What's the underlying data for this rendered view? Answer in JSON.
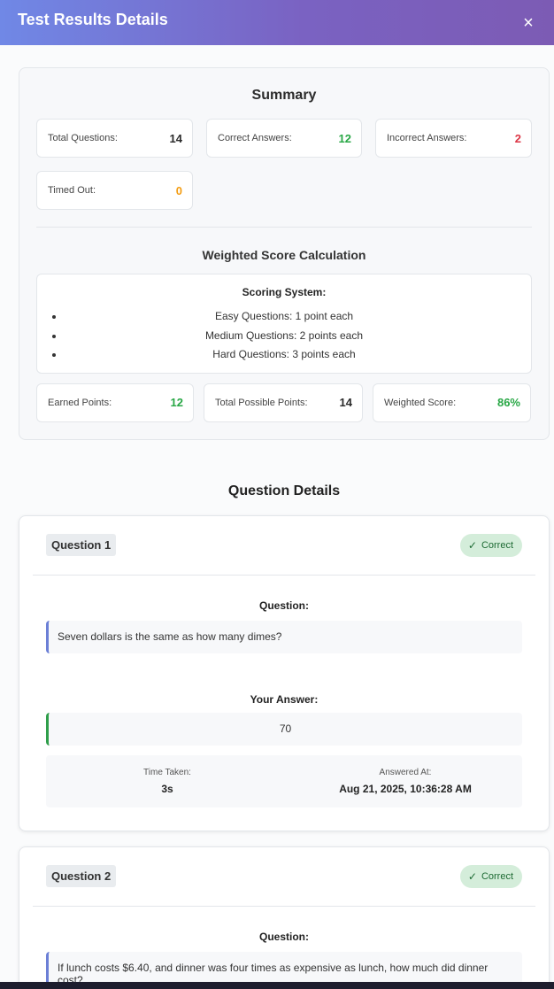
{
  "modal": {
    "title": "Test Results Details",
    "close_label": "×"
  },
  "summary": {
    "title": "Summary",
    "stats": [
      {
        "label": "Total Questions:",
        "value": "14"
      },
      {
        "label": "Correct Answers:",
        "value": "12"
      },
      {
        "label": "Incorrect Answers:",
        "value": "2"
      },
      {
        "label": "Timed Out:",
        "value": "0"
      }
    ],
    "weighted_title": "Weighted Score Calculation",
    "scoring_title": "Scoring System:",
    "scoring_items": [
      "Easy Questions: 1 point each",
      "Medium Questions: 2 points each",
      "Hard Questions: 3 points each"
    ],
    "points": [
      {
        "label": "Earned Points:",
        "value": "12"
      },
      {
        "label": "Total Possible Points:",
        "value": "14"
      },
      {
        "label": "Weighted Score:",
        "value": "86%"
      }
    ]
  },
  "details": {
    "title": "Question Details",
    "questions": [
      {
        "number": "Question 1",
        "status": "Correct",
        "question_label": "Question:",
        "question": "Seven dollars is the same as how many dimes?",
        "answer_label": "Your Answer:",
        "answer": "70",
        "time_label": "Time Taken:",
        "time": "3s",
        "answered_label": "Answered At:",
        "answered": "Aug 21, 2025, 10:36:28 AM"
      },
      {
        "number": "Question 2",
        "status": "Correct",
        "question_label": "Question:",
        "question": "If lunch costs $6.40, and dinner was four times as expensive as lunch, how much did dinner cost?"
      }
    ]
  },
  "colors": {
    "header_start": "#7088e6",
    "header_end": "#7c5bb4",
    "correct_green": "#28a745",
    "incorrect_red": "#dc3545",
    "timeout_orange": "#f39c12",
    "badge_bg": "#d4edda"
  },
  "icons": {
    "close": "close-icon",
    "correct": "check-icon"
  }
}
